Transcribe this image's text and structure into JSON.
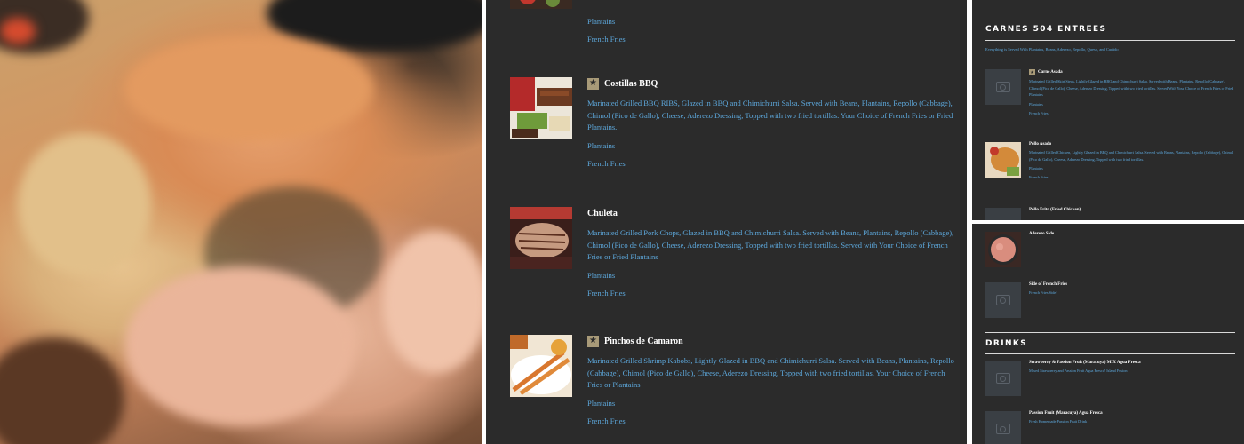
{
  "middle": {
    "top_options": [
      "Plantains",
      "French Fries"
    ],
    "items": [
      {
        "name": "Costillas BBQ",
        "featured": true,
        "description": "Marinated Grilled BBQ RIBS, Glazed in BBQ and Chimichurri Salsa. Served with Beans, Plantains, Repollo (Cabbage), Chimol (Pico de Gallo), Cheese, Aderezo Dressing, Topped with two fried tortillas. Your Choice of French Fries or Fried Plantains.",
        "options": [
          "Plantains",
          "French Fries"
        ]
      },
      {
        "name": "Chuleta",
        "featured": false,
        "description": "Marinated Grilled Pork Chops, Glazed in BBQ and Chimichurri Salsa. Served with Beans, Plantains, Repollo (Cabbage), Chimol (Pico de Gallo), Cheese, Aderezo Dressing, Topped with two fried tortillas. Served with Your Choice of French Fries or Fried Plantains",
        "options": [
          "Plantains",
          "French Fries"
        ]
      },
      {
        "name": "Pinchos de Camaron",
        "featured": true,
        "description": "Marinated Grilled Shrimp Kabobs, Lightly Glazed in BBQ and Chimichurri Salsa. Served with Beans, Plantains, Repollo (Cabbage), Chimol (Pico de Gallo), Cheese, Aderezo Dressing, Topped with two fried tortillas. Your Choice of French Fries or Plantains",
        "options": [
          "Plantains",
          "French Fries"
        ]
      }
    ]
  },
  "right_top": {
    "section_title": "CARNES 504 ENTREES",
    "section_note": "Everything is Served With Plantains, Beans, Aderezo, Repollo, Queso, and Curtido",
    "items": [
      {
        "name": "Carne Asada",
        "featured": true,
        "description": "Marinated Grilled Skirt Steak, Lightly Glazed in BBQ and Chimichurri Salsa. Served with Beans, Plantains, Repollo (Cabbage), Chimol (Pico de Gallo), Cheese, Aderezo Dressing, Topped with two fried tortillas. Served With Your Choice of French Fries or Fried Plantains",
        "options": [
          "Plantains",
          "French Fries"
        ]
      },
      {
        "name": "Pollo Asado",
        "featured": false,
        "description": "Marinated Grilled Chicken, Lightly Glazed in BBQ and Chimichurri Salsa. Served with Beans, Plantains, Repollo (Cabbage), Chimol (Pico de Gallo), Cheese, Aderezo Dressing, Topped with two fried tortillas.",
        "options": [
          "Plantains",
          "French Fries"
        ]
      },
      {
        "name": "Pollo Frito (Fried Chicken)",
        "featured": false
      }
    ]
  },
  "right_bottom": {
    "items": [
      {
        "name": "Aderezo Side"
      },
      {
        "name": "Side of French Fries",
        "description": "French Fries Side!"
      }
    ],
    "drinks_title": "DRINKS",
    "drinks": [
      {
        "name": "Strawberry & Passion Fruit (Maracuya) MIX Agua Fresca",
        "description": "Mixed Strawberry and Passion Fruit Agua Fresca! Island Fusion"
      },
      {
        "name": "Passion Fruit (Maracuya) Agua Fresca",
        "description": "Fresh Homemade Passion Fruit Drink"
      }
    ]
  },
  "colors": {
    "panel_bg": "#2b2b2b",
    "link_blue": "#5da8dc",
    "badge_gold": "#a89a78",
    "placeholder_bg": "#3a3f44"
  },
  "icons": [
    "star-badge-icon",
    "camera-placeholder-icon"
  ]
}
